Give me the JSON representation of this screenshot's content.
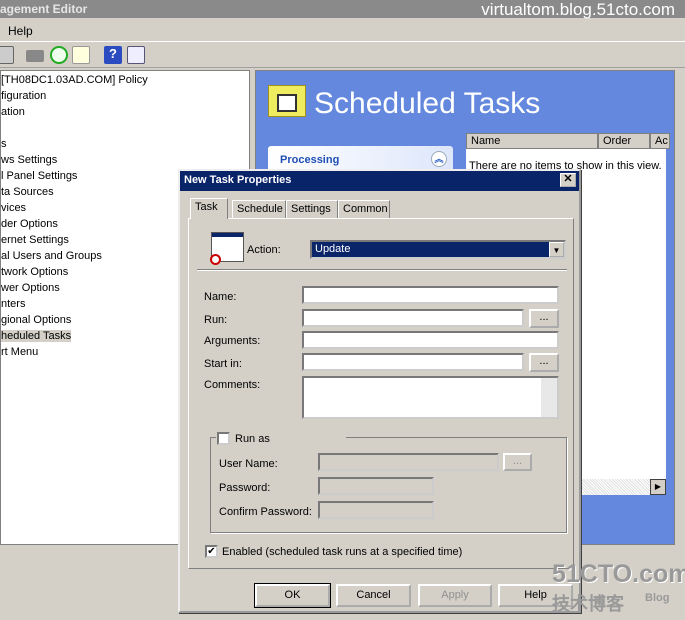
{
  "window": {
    "title": "agement Editor",
    "watermark": "virtualtom.blog.51cto.com"
  },
  "menu": {
    "help": "Help"
  },
  "toolbar": {
    "icons": [
      "clipboard-icon",
      "print-icon",
      "refresh-icon",
      "export-icon",
      "help-icon",
      "show-hide-icon"
    ]
  },
  "tree": {
    "items": [
      {
        "label": "[TH08DC1.03AD.COM] Policy"
      },
      {
        "label": "figuration"
      },
      {
        "label": "ation"
      },
      {
        "label": ""
      },
      {
        "label": "s"
      },
      {
        "label": "ws Settings"
      },
      {
        "label": "l Panel Settings"
      },
      {
        "label": "ta Sources"
      },
      {
        "label": "vices"
      },
      {
        "label": "der Options"
      },
      {
        "label": "ernet Settings"
      },
      {
        "label": "al Users and Groups"
      },
      {
        "label": "twork Options"
      },
      {
        "label": "wer Options"
      },
      {
        "label": "nters"
      },
      {
        "label": "gional Options"
      },
      {
        "label": "heduled Tasks",
        "selected": true
      },
      {
        "label": "rt Menu"
      }
    ]
  },
  "right": {
    "title": "Scheduled Tasks",
    "processing": "Processing",
    "columns": [
      "Name",
      "Order",
      "Ac"
    ],
    "empty_text": "There are no items to show in this view.",
    "bg_color": "#6388dd"
  },
  "dialog": {
    "title": "New Task Properties",
    "close": "✕",
    "tabs": [
      "Task",
      "Schedule",
      "Settings",
      "Common"
    ],
    "action_label": "Action:",
    "action_value": "Update",
    "name_label": "Name:",
    "name_value": "",
    "run_label": "Run:",
    "run_value": "",
    "browse": "...",
    "arguments_label": "Arguments:",
    "arguments_value": "",
    "startin_label": "Start in:",
    "startin_value": "",
    "comments_label": "Comments:",
    "comments_value": "",
    "runas_label": "Run as",
    "runas_checked": false,
    "username_label": "User Name:",
    "password_label": "Password:",
    "confirm_label": "Confirm Password:",
    "enabled_label": "Enabled (scheduled task runs at a specified time)",
    "enabled_checked": true,
    "buttons": {
      "ok": "OK",
      "cancel": "Cancel",
      "apply": "Apply",
      "help": "Help"
    },
    "title_color": "#0a246a"
  },
  "site_watermark": {
    "main": "51CTO.com",
    "sub": "技术博客",
    "blog": "Blog"
  }
}
